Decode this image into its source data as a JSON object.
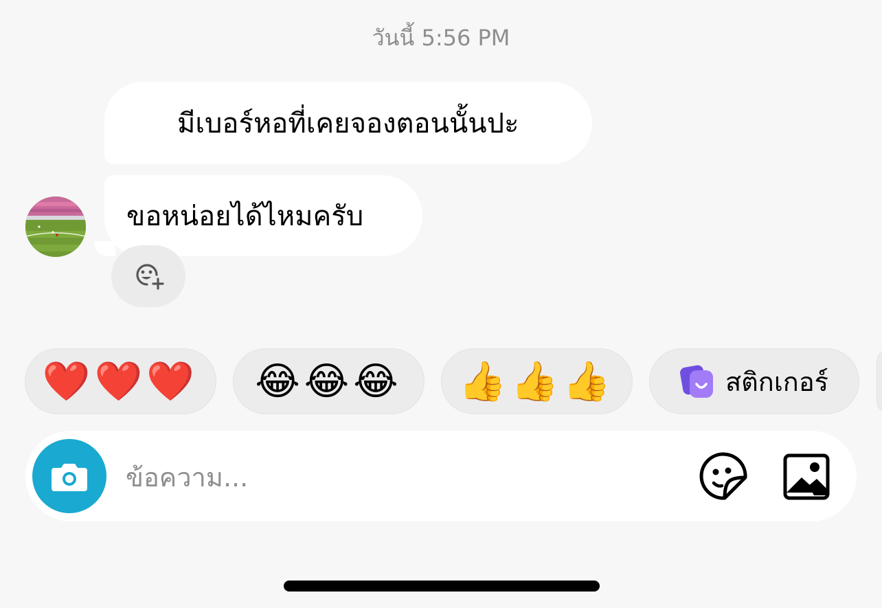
{
  "timestamp": "วันนี้ 5:56 PM",
  "messages": [
    {
      "text": "มีเบอร์หอที่เคยจองตอนนั้นปะ"
    },
    {
      "text": "ขอหน่อยได้ไหมครับ"
    }
  ],
  "quick_replies": [
    {
      "emoji": "❤️❤️❤️"
    },
    {
      "emoji": "😂😂😂"
    },
    {
      "emoji": "👍👍👍"
    },
    {
      "label": "สติกเกอร์"
    }
  ],
  "composer": {
    "placeholder": "ข้อความ..."
  },
  "colors": {
    "camera_button": "#1aa9d0",
    "background": "#f7f7f7",
    "sticker_logo": "#8a5cf0"
  }
}
